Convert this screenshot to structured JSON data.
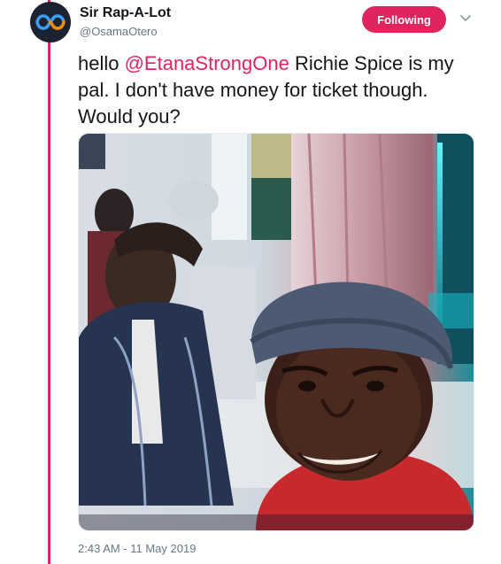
{
  "author": {
    "name": "Sir Rap-A-Lot",
    "handle": "@OsamaOtero",
    "avatar_icon": "infinity-logo-icon"
  },
  "follow_button": {
    "label": "Following"
  },
  "menu": {
    "icon": "chevron-down-icon"
  },
  "tweet": {
    "text_before": "hello ",
    "mention": "@EtanaStrongOne",
    "text_after": " Richie Spice is my pal. I don't have money for ticket though. Would you?"
  },
  "photo": {
    "description_icon": "photo"
  },
  "timestamp": "2:43 AM - 11 May 2019",
  "colors": {
    "accent": "#e0245e",
    "text": "#14171a",
    "muted": "#657786"
  }
}
